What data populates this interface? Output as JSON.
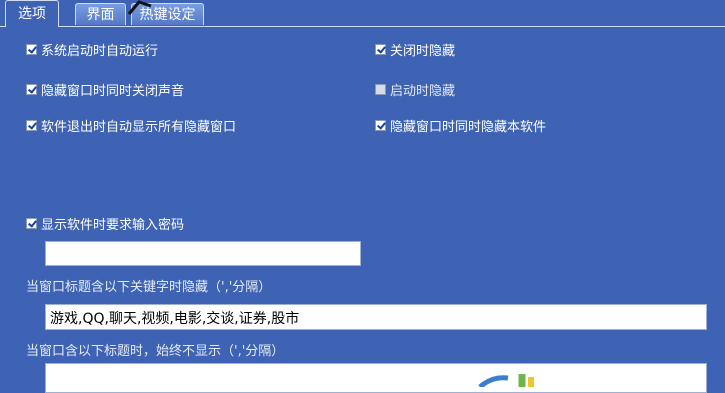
{
  "tabs": [
    {
      "label": "选项",
      "active": true
    },
    {
      "label": "界面",
      "active": false
    },
    {
      "label": "热键设定",
      "active": false
    }
  ],
  "options": {
    "left": [
      {
        "label": "系统启动时自动运行",
        "checked": true
      },
      {
        "label": "隐藏窗口时同时关闭声音",
        "checked": true
      },
      {
        "label": "软件退出时自动显示所有隐藏窗口",
        "checked": true
      }
    ],
    "right": [
      {
        "label": "关闭时隐藏",
        "checked": true
      },
      {
        "label": "启动时隐藏",
        "checked": false
      },
      {
        "label": "隐藏窗口时同时隐藏本软件",
        "checked": true
      }
    ]
  },
  "password": {
    "label": "显示软件时要求输入密码",
    "checked": true,
    "value": ""
  },
  "keywords": {
    "label": "当窗口标题含以下关键字时隐藏（','分隔）",
    "value": "游戏,QQ,聊天,视频,电影,交谈,证券,股市"
  },
  "never_show": {
    "label": "当窗口含以下标题时，始终不显示（','分隔）",
    "value": ""
  },
  "colors": {
    "background": "#3f63b4",
    "tab_inactive": "#5f83cc",
    "check_mark": "#1a3fa0"
  }
}
